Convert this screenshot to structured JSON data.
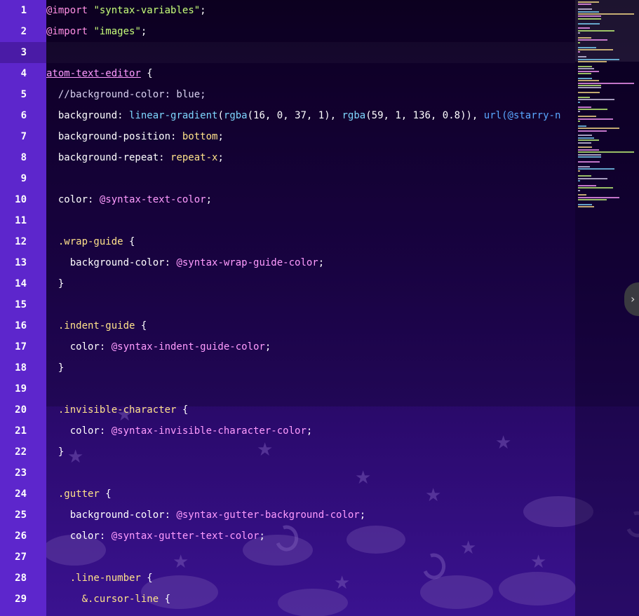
{
  "editor": {
    "line_numbers": [
      "1",
      "2",
      "3",
      "4",
      "5",
      "6",
      "7",
      "8",
      "9",
      "10",
      "11",
      "12",
      "13",
      "14",
      "15",
      "16",
      "17",
      "18",
      "19",
      "20",
      "21",
      "22",
      "23",
      "24",
      "25",
      "26",
      "27",
      "28",
      "29"
    ],
    "cursor_line_index": 2,
    "lines": [
      [
        {
          "t": "@import",
          "c": "at"
        },
        {
          "t": " ",
          "c": "punc"
        },
        {
          "t": "\"syntax-variables\"",
          "c": "str"
        },
        {
          "t": ";",
          "c": "punc"
        }
      ],
      [
        {
          "t": "@import",
          "c": "at"
        },
        {
          "t": " ",
          "c": "punc"
        },
        {
          "t": "\"images\"",
          "c": "str"
        },
        {
          "t": ";",
          "c": "punc"
        }
      ],
      [],
      [
        {
          "t": "atom-text-editor",
          "c": "sel"
        },
        {
          "t": " {",
          "c": "punc"
        }
      ],
      [
        {
          "t": "  //background-color: blue;",
          "c": "comment"
        }
      ],
      [
        {
          "t": "  background",
          "c": "prop"
        },
        {
          "t": ": ",
          "c": "punc"
        },
        {
          "t": "linear-gradient",
          "c": "fn"
        },
        {
          "t": "(",
          "c": "punc"
        },
        {
          "t": "rgba",
          "c": "fn"
        },
        {
          "t": "(16, ",
          "c": "num"
        },
        {
          "t": "0, ",
          "c": "num"
        },
        {
          "t": "37, ",
          "c": "num"
        },
        {
          "t": "1), ",
          "c": "num"
        },
        {
          "t": "rgba",
          "c": "fn"
        },
        {
          "t": "(59, 1, 136, 0.8)), ",
          "c": "num"
        },
        {
          "t": "url(@starry-n",
          "c": "url"
        }
      ],
      [
        {
          "t": "  background-position",
          "c": "prop"
        },
        {
          "t": ": ",
          "c": "punc"
        },
        {
          "t": "bottom",
          "c": "val"
        },
        {
          "t": ";",
          "c": "punc"
        }
      ],
      [
        {
          "t": "  background-repeat",
          "c": "prop"
        },
        {
          "t": ": ",
          "c": "punc"
        },
        {
          "t": "repeat-x",
          "c": "val"
        },
        {
          "t": ";",
          "c": "punc"
        }
      ],
      [],
      [
        {
          "t": "  color",
          "c": "prop"
        },
        {
          "t": ": ",
          "c": "punc"
        },
        {
          "t": "@syntax-text-color",
          "c": "var"
        },
        {
          "t": ";",
          "c": "punc"
        }
      ],
      [],
      [
        {
          "t": "  .wrap-guide",
          "c": "cls"
        },
        {
          "t": " {",
          "c": "punc"
        }
      ],
      [
        {
          "t": "    background-color",
          "c": "prop"
        },
        {
          "t": ": ",
          "c": "punc"
        },
        {
          "t": "@syntax-wrap-guide-color",
          "c": "var"
        },
        {
          "t": ";",
          "c": "punc"
        }
      ],
      [
        {
          "t": "  }",
          "c": "punc"
        }
      ],
      [],
      [
        {
          "t": "  .indent-guide",
          "c": "cls"
        },
        {
          "t": " {",
          "c": "punc"
        }
      ],
      [
        {
          "t": "    color",
          "c": "prop"
        },
        {
          "t": ": ",
          "c": "punc"
        },
        {
          "t": "@syntax-indent-guide-color",
          "c": "var"
        },
        {
          "t": ";",
          "c": "punc"
        }
      ],
      [
        {
          "t": "  }",
          "c": "punc"
        }
      ],
      [],
      [
        {
          "t": "  .invisible-character",
          "c": "cls"
        },
        {
          "t": " {",
          "c": "punc"
        }
      ],
      [
        {
          "t": "    color",
          "c": "prop"
        },
        {
          "t": ": ",
          "c": "punc"
        },
        {
          "t": "@syntax-invisible-character-color",
          "c": "var"
        },
        {
          "t": ";",
          "c": "punc"
        }
      ],
      [
        {
          "t": "  }",
          "c": "punc"
        }
      ],
      [],
      [
        {
          "t": "  .gutter",
          "c": "cls"
        },
        {
          "t": " {",
          "c": "punc"
        }
      ],
      [
        {
          "t": "    background-color",
          "c": "prop"
        },
        {
          "t": ": ",
          "c": "punc"
        },
        {
          "t": "@syntax-gutter-background-color",
          "c": "var"
        },
        {
          "t": ";",
          "c": "punc"
        }
      ],
      [
        {
          "t": "    color",
          "c": "prop"
        },
        {
          "t": ": ",
          "c": "punc"
        },
        {
          "t": "@syntax-gutter-text-color",
          "c": "var"
        },
        {
          "t": ";",
          "c": "punc"
        }
      ],
      [],
      [
        {
          "t": "    .line-number",
          "c": "cls"
        },
        {
          "t": " {",
          "c": "punc"
        }
      ],
      [
        {
          "t": "      &.cursor-line",
          "c": "cls"
        },
        {
          "t": " {",
          "c": "punc"
        }
      ]
    ]
  },
  "scroll_handle": {
    "icon": "chevron-right-icon",
    "glyph": "›"
  },
  "colors": {
    "gutter": "#5d26cc",
    "background_top": "#0f0027",
    "background_bottom": "#3a1290"
  }
}
